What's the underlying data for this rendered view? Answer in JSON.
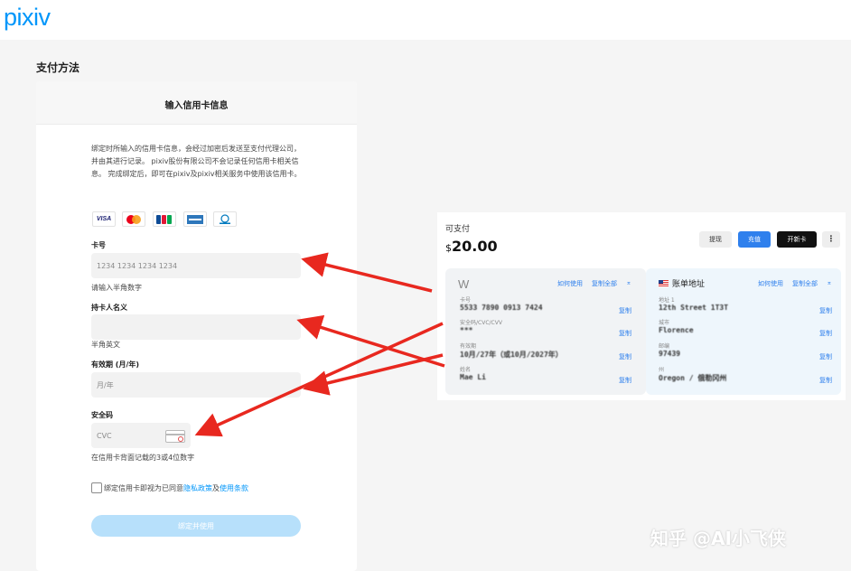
{
  "header": {
    "logo": "pixiv"
  },
  "page": {
    "section_title": "支付方法"
  },
  "card_form": {
    "title": "输入信用卡信息",
    "notice": "绑定时所输入的信用卡信息，会经过加密后发送至支付代理公司，并由其进行记录。 pixiv股份有限公司不会记录任何信用卡相关信息。 完成绑定后，即可在pixiv及pixiv相关服务中使用该信用卡。",
    "brands": [
      "VISA",
      "Mastercard",
      "JCB",
      "American Express",
      "Diners Club"
    ],
    "card_number": {
      "label": "卡号",
      "placeholder": "1234 1234 1234 1234",
      "help": "请输入半角数字"
    },
    "holder": {
      "label": "持卡人名义",
      "placeholder": "",
      "help": "半角英文"
    },
    "expiry": {
      "label": "有效期 (月/年)",
      "placeholder": "月/年"
    },
    "cvc": {
      "label": "安全码",
      "placeholder": "CVC",
      "help": "在信用卡背面记载的3或4位数字"
    },
    "agree": {
      "text_before": "绑定信用卡即视为已同意",
      "privacy": "隐私政策",
      "and": "及",
      "terms": "使用条款"
    },
    "submit": "绑定并使用"
  },
  "wallet": {
    "balance_label": "可支付",
    "currency": "$",
    "balance": "20.00",
    "buttons": {
      "withdraw": "提现",
      "topup": "充值",
      "new_card": "开新卡",
      "more": "⋮"
    },
    "card": {
      "logo": "W",
      "how_to_use": "如何使用",
      "copy_all": "复制全部",
      "hide": "⌅",
      "fields": [
        {
          "label": "卡号",
          "value": "5533 7890 0913 7424",
          "copy": "复制"
        },
        {
          "label": "安全码/CVC/CVV",
          "value": "***",
          "copy": "复制"
        },
        {
          "label": "有效期",
          "value": "10月/27年（或10月/2027年）",
          "copy": "复制"
        },
        {
          "label": "姓名",
          "value": "Mae Li",
          "copy": "复制"
        }
      ]
    },
    "address": {
      "title": "账单地址",
      "how_to_use": "如何使用",
      "copy_all": "复制全部",
      "hide": "⌅",
      "fields": [
        {
          "label": "地址 1",
          "value": "12th Street 1T3T",
          "copy": "复制"
        },
        {
          "label": "城市",
          "value": "Florence",
          "copy": "复制"
        },
        {
          "label": "邮编",
          "value": "97439",
          "copy": "复制"
        },
        {
          "label": "州",
          "value": "Oregon / 俄勒冈州",
          "copy": "复制"
        }
      ]
    }
  },
  "watermark": "知乎 @AI小飞侠",
  "colors": {
    "accent": "#0096fa",
    "arrow": "#e8281f",
    "topup": "#2f80ed"
  }
}
